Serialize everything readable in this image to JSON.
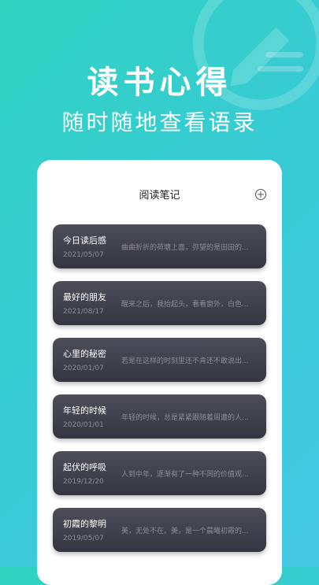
{
  "hero": {
    "title": "读书心得",
    "subtitle": "随时随地查看语录"
  },
  "card": {
    "title": "阅读笔记",
    "add_icon": "plus-circle-icon"
  },
  "notes": [
    {
      "title": "今日读后感",
      "date": "2021/05/07",
      "preview": "曲曲折折的荷塘上面，弥望的是田田的..."
    },
    {
      "title": "最好的朋友",
      "date": "2021/08/17",
      "preview": "醒来之后，我抬起头，看看窗外，白色..."
    },
    {
      "title": "心里的秘密",
      "date": "2020/01/07",
      "preview": "若是在这样的时刻里还不肯还不敢说出..."
    },
    {
      "title": "年轻的时候",
      "date": "2020/01/01",
      "preview": "年轻的时候，总是紧紧跟随着周遭的人..."
    },
    {
      "title": "起伏的呼吸",
      "date": "2019/12/20",
      "preview": "人到中年，逐渐有了一种不同的价值观..."
    },
    {
      "title": "初霞的黎明",
      "date": "2019/05/07",
      "preview": "美，无处不在。美，是一个晨曦初霞的..."
    }
  ],
  "colors": {
    "background_start": "#2fd3c0",
    "background_end": "#45c7e3",
    "note_card": "#3e3d4a"
  }
}
